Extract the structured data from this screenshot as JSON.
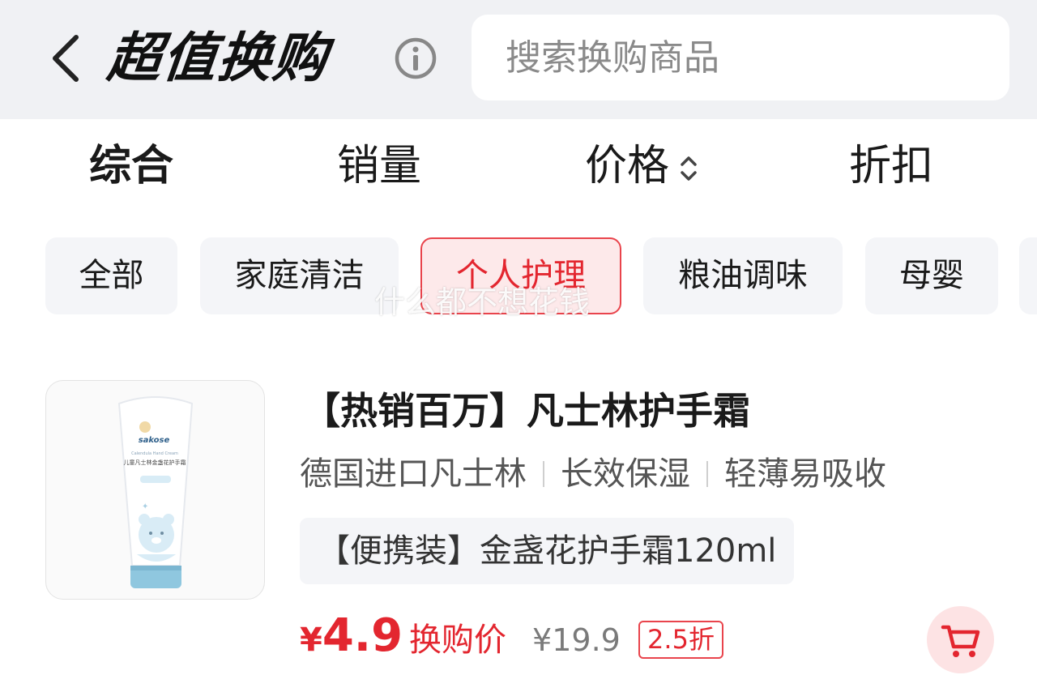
{
  "header": {
    "title": "超值换购",
    "search_placeholder": "搜索换购商品"
  },
  "sort_tabs": [
    {
      "label": "综合",
      "active": true
    },
    {
      "label": "销量"
    },
    {
      "label": "价格"
    },
    {
      "label": "折扣"
    }
  ],
  "categories": [
    {
      "label": "全部"
    },
    {
      "label": "家庭清洁"
    },
    {
      "label": "个人护理",
      "active": true
    },
    {
      "label": "粮油调味"
    },
    {
      "label": "母婴"
    }
  ],
  "watermark": "什么都不想花钱",
  "product": {
    "title": "【热销百万】凡士林护手霜",
    "tags": [
      "德国进口凡士林",
      "长效保湿",
      "轻薄易吸收"
    ],
    "variant": "【便携装】金盏花护手霜120ml",
    "price_currency": "¥",
    "price_value": "4.9",
    "price_label": "换购价",
    "original_price": "¥19.9",
    "discount": "2.5折",
    "image_brand": "sakose",
    "image_subtitle": "Calendula Hand Cream",
    "image_name": "儿童凡士林金盏花护手霜"
  },
  "colors": {
    "accent": "#e3262f",
    "header_bg": "#f0f1f4",
    "chip_bg": "#f4f5f8",
    "chip_active_bg": "#fde9ea"
  }
}
